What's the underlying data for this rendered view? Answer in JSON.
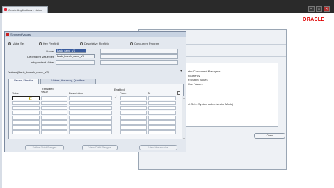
{
  "app": {
    "tab_title": "Oracle Applications - vision",
    "minimize_glyph": "–",
    "maximize_glyph": "□",
    "close_glyph": "✕",
    "brand": "ORACLE"
  },
  "background_window": {
    "list_items": [
      "ster Concurrent Managers",
      "ncurrency",
      "t System Values",
      "User Values",
      "nt Sets (System Administrator Mode)"
    ],
    "open_button": "Open"
  },
  "dialog": {
    "title": "Segment Values",
    "radios": [
      {
        "label": "Value Set",
        "selected": true
      },
      {
        "label": "Key Flexfield",
        "selected": false
      },
      {
        "label": "Descriptive Flexfield",
        "selected": false
      },
      {
        "label": "Concurrent Program",
        "selected": false
      }
    ],
    "name_label": "Name",
    "name_value": "Bank_name_VS",
    "dependent_label": "Dependent Value Set",
    "dependent_value": "Bank_branch_name_VS",
    "independent_label": "Independent Value",
    "values_line": "Values (Bank_branch_name_VS)",
    "tabs": [
      "Values, Effective",
      "Values, Hierarchy, Qualifiers"
    ],
    "columns": {
      "value": "Value",
      "translated": "Translated Value",
      "description": "Description",
      "enabled": "Enabled",
      "from": "From",
      "to": "To"
    },
    "first_row_checked_glyph": "✓",
    "buttons": [
      "Define Child Ranges",
      "View Child Ranges",
      "View Hierarchies"
    ]
  },
  "colors": {
    "titlebar": "#2a2a2a",
    "oracle_red": "#e00000",
    "selection_blue": "#3a5c9e",
    "form_bg": "#e3e8ef"
  }
}
